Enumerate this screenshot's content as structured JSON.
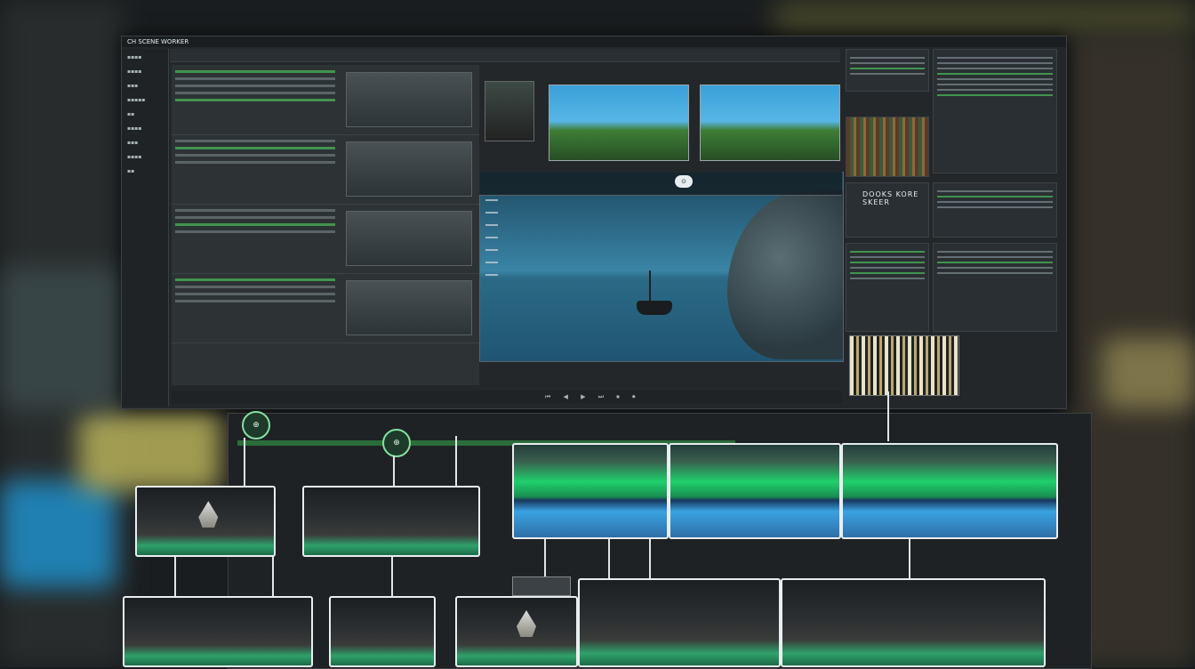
{
  "app": {
    "title": "CH SCENE WORKER"
  },
  "left_rail": {
    "items": [
      "▪▪▪▪",
      "▪▪▪▪",
      "▪▪▪",
      "▪▪▪▪▪",
      "▪▪",
      "▪▪▪▪",
      "▪▪▪",
      "▪▪▪▪",
      "▪▪"
    ]
  },
  "viewer": {
    "badge": "⊙"
  },
  "right_panel": {
    "heading": "DOOKS KORE SKEER"
  },
  "timeline": {
    "nodes": [
      "⊕",
      "⊕"
    ]
  },
  "transport": {
    "controls": "⏮ ◀ ▶ ⏭ ⏹ ⏺"
  },
  "colors": {
    "accent": "#4cbd5a",
    "frame": "#e8eef0",
    "background": "#1a1d1f"
  }
}
